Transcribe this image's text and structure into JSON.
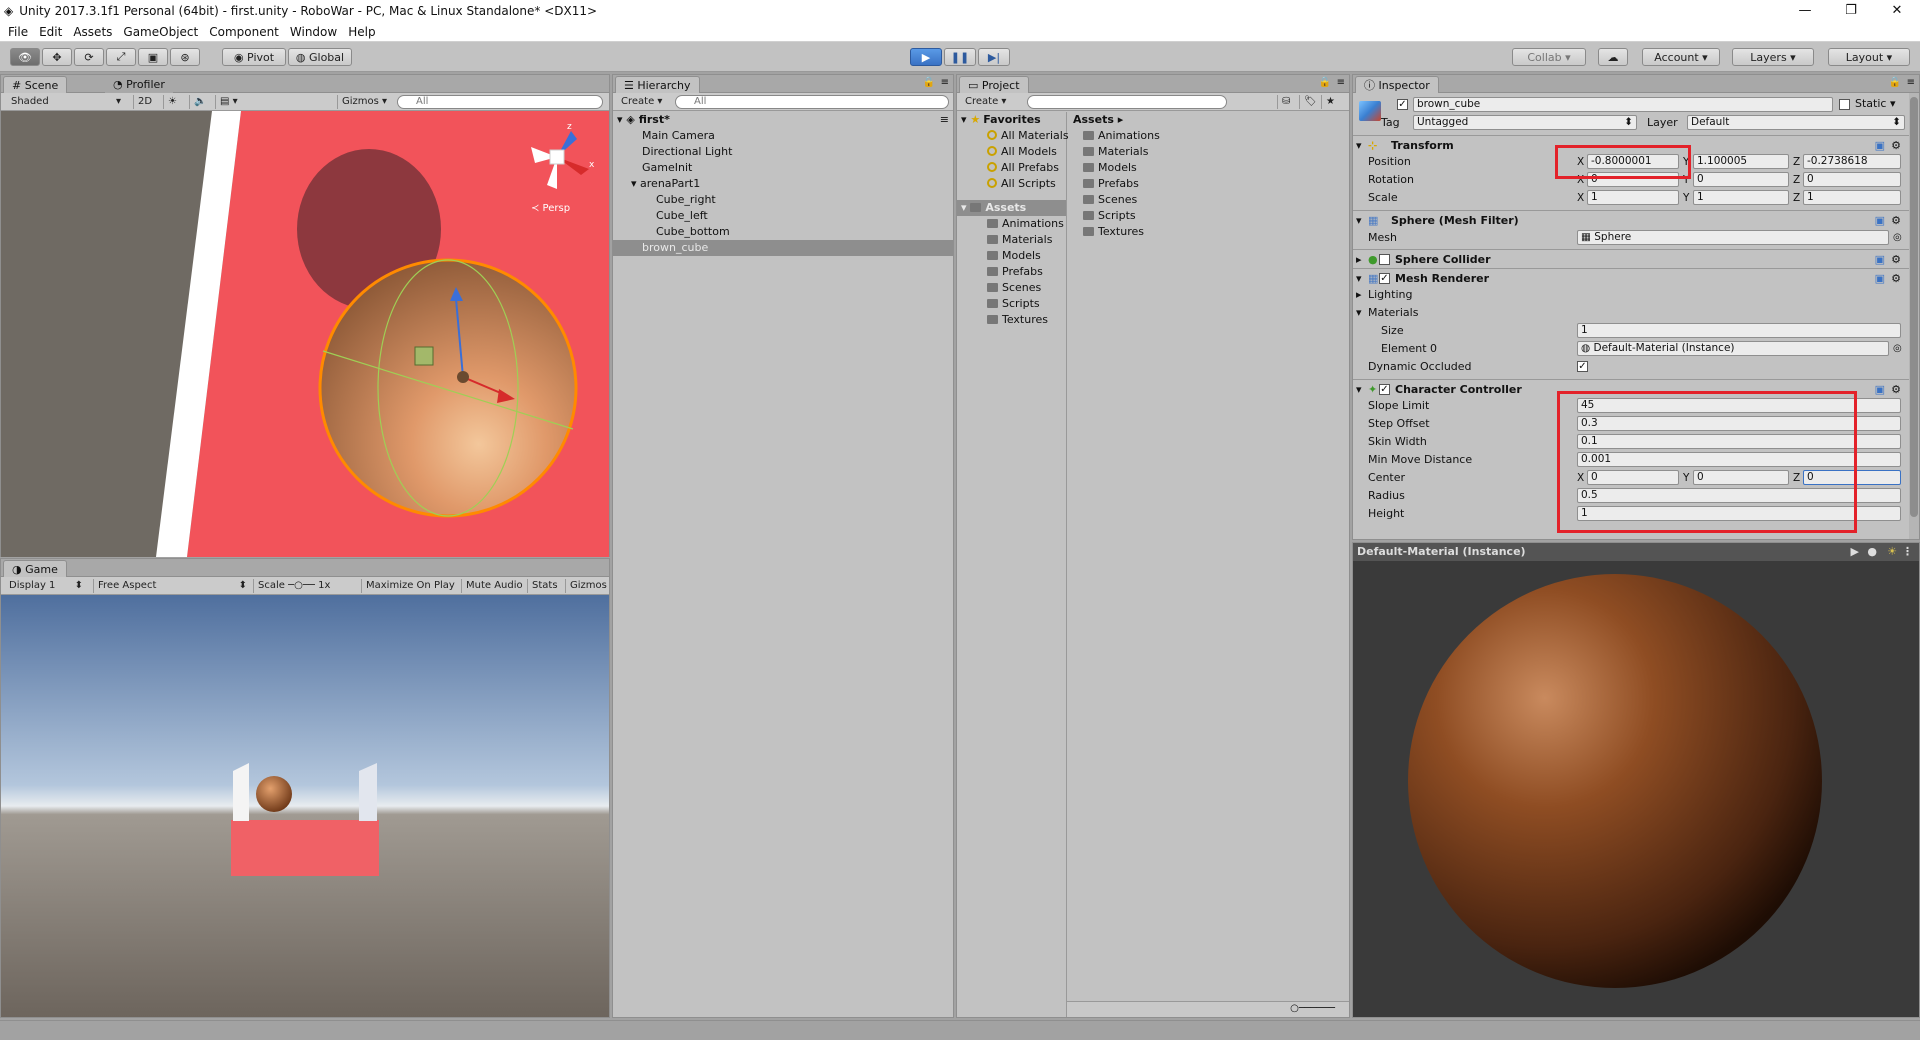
{
  "window": {
    "title": "Unity 2017.3.1f1 Personal (64bit) - first.unity - RoboWar - PC, Mac & Linux Standalone* <DX11>",
    "minimize": "—",
    "restore": "❐",
    "close": "✕"
  },
  "menu": [
    "File",
    "Edit",
    "Assets",
    "GameObject",
    "Component",
    "Window",
    "Help"
  ],
  "toolbar": {
    "pivot": "Pivot",
    "global": "Global",
    "collab": "Collab ▾",
    "account": "Account",
    "layers": "Layers",
    "layout": "Layout"
  },
  "scene": {
    "tab": "Scene",
    "profiler_tab": "Profiler",
    "shading": "Shaded",
    "mode2d": "2D",
    "gizmos": "Gizmos ▾",
    "search_placeholder": "All",
    "persp": "≺ Persp"
  },
  "game": {
    "tab": "Game",
    "display": "Display 1",
    "aspect": "Free Aspect",
    "scale_label": "Scale",
    "scale_value": "1x",
    "maximize": "Maximize On Play",
    "mute": "Mute Audio",
    "stats": "Stats",
    "gizmos": "Gizmos"
  },
  "hierarchy": {
    "tab": "Hierarchy",
    "create": "Create ▾",
    "search_placeholder": "All",
    "scene_name": "first*",
    "items": [
      {
        "label": "Main Camera",
        "indent": 1
      },
      {
        "label": "Directional Light",
        "indent": 1
      },
      {
        "label": "GameInit",
        "indent": 1
      },
      {
        "label": "arenaPart1",
        "indent": 1,
        "expanded": true
      },
      {
        "label": "Cube_right",
        "indent": 2
      },
      {
        "label": "Cube_left",
        "indent": 2
      },
      {
        "label": "Cube_bottom",
        "indent": 2
      },
      {
        "label": "brown_cube",
        "indent": 1,
        "selected": true
      }
    ]
  },
  "project": {
    "tab": "Project",
    "create": "Create ▾",
    "favorites_label": "Favorites",
    "favorites": [
      "All Materials",
      "All Models",
      "All Prefabs",
      "All Scripts"
    ],
    "assets_label": "Assets",
    "assets_tree": [
      "Animations",
      "Materials",
      "Models",
      "Prefabs",
      "Scenes",
      "Scripts",
      "Textures"
    ],
    "breadcrumb": "Assets ▸",
    "assets_list": [
      "Animations",
      "Materials",
      "Models",
      "Prefabs",
      "Scenes",
      "Scripts",
      "Textures"
    ]
  },
  "inspector": {
    "tab": "Inspector",
    "object_name": "brown_cube",
    "static_label": "Static ▾",
    "tag_label": "Tag",
    "tag_value": "Untagged",
    "layer_label": "Layer",
    "layer_value": "Default",
    "transform": {
      "title": "Transform",
      "position_label": "Position",
      "position": [
        "-0.8000001",
        "1.100005",
        "-0.2738618"
      ],
      "rotation_label": "Rotation",
      "rotation": [
        "0",
        "0",
        "0"
      ],
      "scale_label": "Scale",
      "scale": [
        "1",
        "1",
        "1"
      ]
    },
    "mesh_filter": {
      "title": "Sphere (Mesh Filter)",
      "mesh_label": "Mesh",
      "mesh_value": "Sphere"
    },
    "sphere_collider": {
      "title": "Sphere Collider"
    },
    "mesh_renderer": {
      "title": "Mesh Renderer",
      "lighting": "Lighting",
      "materials": "Materials",
      "size_label": "Size",
      "size_value": "1",
      "element_label": "Element 0",
      "element_value": "Default-Material (Instance)",
      "occluded_label": "Dynamic Occluded"
    },
    "character_controller": {
      "title": "Character Controller",
      "slope_label": "Slope Limit",
      "slope": "45",
      "step_label": "Step Offset",
      "step": "0.3",
      "skin_label": "Skin Width",
      "skin": "0.1",
      "minmove_label": "Min Move Distance",
      "minmove": "0.001",
      "center_label": "Center",
      "center": [
        "0",
        "0",
        "0"
      ],
      "radius_label": "Radius",
      "radius": "0.5",
      "height_label": "Height",
      "height": "1"
    },
    "preview_title": "Default-Material (Instance)"
  },
  "axes": {
    "x": "X",
    "y": "Y",
    "z": "Z"
  },
  "colors": {
    "accent": "#3a72c4",
    "highlight_red": "#e3222a",
    "scene_red": "#f2535a",
    "sphere_brown": "#8a4a22"
  }
}
